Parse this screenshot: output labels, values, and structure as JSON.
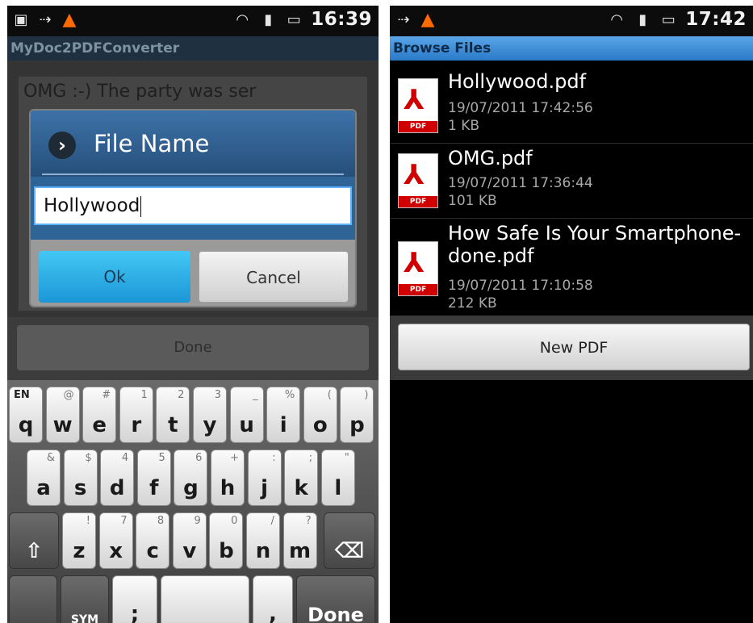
{
  "left": {
    "status": {
      "time": "16:39",
      "icons": [
        "sd-card-icon",
        "usb-icon",
        "warning-icon",
        "wifi-icon",
        "signal-icon",
        "battery-icon"
      ]
    },
    "app_title": "MyDoc2PDFConverter",
    "editor_text": "OMG :-) The party was ser",
    "dialog": {
      "title": "File Name",
      "input_value": "Hollywood",
      "ok_label": "Ok",
      "cancel_label": "Cancel"
    },
    "done_label": "Done",
    "keyboard": {
      "row1": [
        {
          "k": "q",
          "s": "EN"
        },
        {
          "k": "w",
          "s": "@"
        },
        {
          "k": "e",
          "s": "#"
        },
        {
          "k": "r",
          "s": "1"
        },
        {
          "k": "t",
          "s": "2"
        },
        {
          "k": "y",
          "s": "3"
        },
        {
          "k": "u",
          "s": "_"
        },
        {
          "k": "i",
          "s": "%"
        },
        {
          "k": "o",
          "s": "("
        },
        {
          "k": "p",
          "s": ")"
        }
      ],
      "row2": [
        {
          "k": "a",
          "s": "&"
        },
        {
          "k": "s",
          "s": "$"
        },
        {
          "k": "d",
          "s": "4"
        },
        {
          "k": "f",
          "s": "5"
        },
        {
          "k": "g",
          "s": "6"
        },
        {
          "k": "h",
          "s": "+"
        },
        {
          "k": "j",
          "s": ":"
        },
        {
          "k": "k",
          "s": ";"
        },
        {
          "k": "l",
          "s": "\""
        }
      ],
      "row3": [
        {
          "k": "z",
          "s": "!"
        },
        {
          "k": "x",
          "s": "7"
        },
        {
          "k": "c",
          "s": "8"
        },
        {
          "k": "v",
          "s": "9"
        },
        {
          "k": "b",
          "s": "0"
        },
        {
          "k": "n",
          "s": "/"
        },
        {
          "k": "m",
          "s": "?"
        }
      ],
      "sym_label": "SYM",
      "semicolon_label": ";",
      "comma_label": ",",
      "period_label": ".",
      "done_key_label": "Done",
      "shift_symbol": "⇧",
      "backspace_symbol": "⌫"
    }
  },
  "right": {
    "status": {
      "time": "17:42",
      "icons": [
        "usb-icon",
        "warning-icon",
        "wifi-icon",
        "signal-icon",
        "battery-icon"
      ]
    },
    "app_title": "Browse Files",
    "files": [
      {
        "name": "Hollywood.pdf",
        "date": "19/07/2011 17:42:56",
        "size": "1 KB"
      },
      {
        "name": "OMG.pdf",
        "date": "19/07/2011 17:36:44",
        "size": "101 KB"
      },
      {
        "name": "How Safe Is Your Smartphone-done.pdf",
        "date": "19/07/2011 17:10:58",
        "size": "212 KB"
      }
    ],
    "new_pdf_label": "New PDF"
  },
  "colors": {
    "title_left_bg": "#1f3140",
    "title_right_bg": "#2a7ac8",
    "dialog_head": "#3d72a8",
    "ok_button": "#1b96d6",
    "pdf_red": "#d10000"
  }
}
